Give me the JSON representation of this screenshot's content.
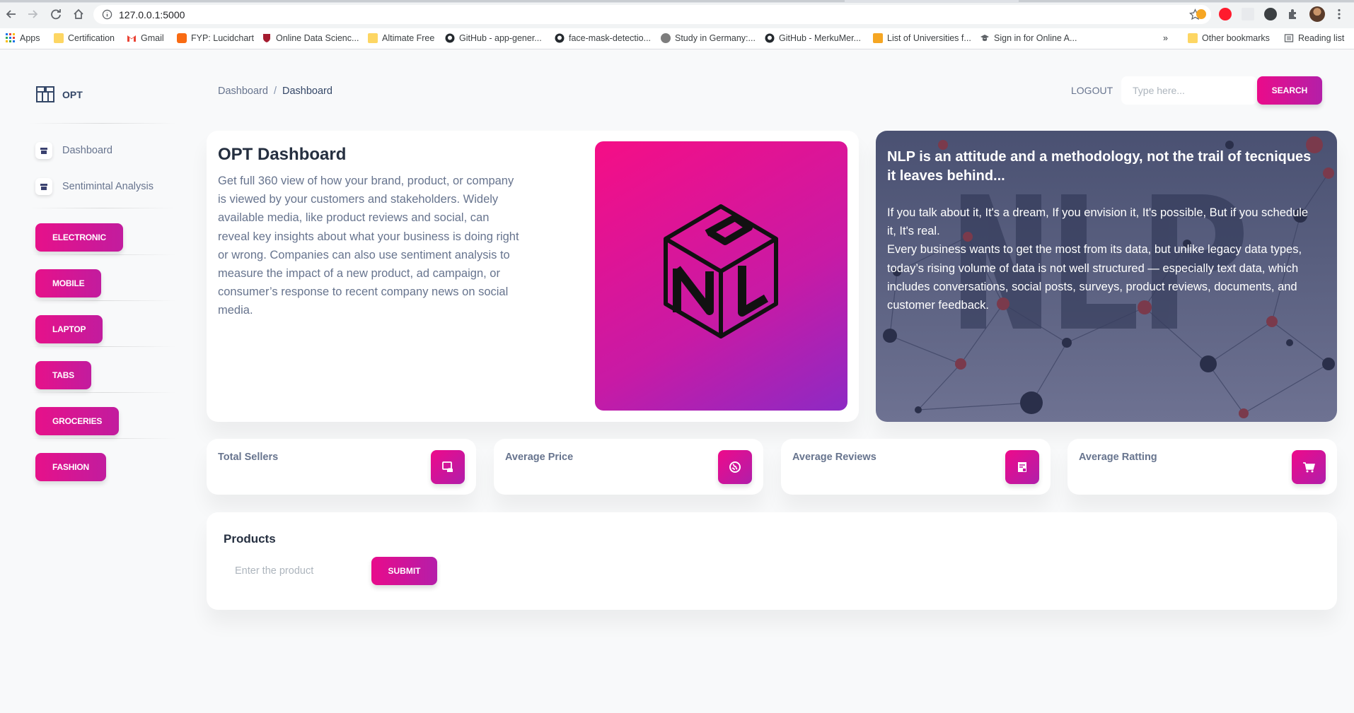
{
  "browser": {
    "url": "127.0.0.1:5000",
    "bookmarks": [
      {
        "label": "Apps",
        "icon": "apps-grid-icon"
      },
      {
        "label": "Certification",
        "icon": "folder-icon"
      },
      {
        "label": "Gmail",
        "icon": "gmail-icon"
      },
      {
        "label": "FYP: Lucidchart",
        "icon": "lucidchart-icon"
      },
      {
        "label": "Online Data Scienc...",
        "icon": "harvard-shield-icon"
      },
      {
        "label": "Altimate Free",
        "icon": "folder-icon"
      },
      {
        "label": "GitHub - app-gener...",
        "icon": "github-icon"
      },
      {
        "label": "face-mask-detectio...",
        "icon": "github-icon"
      },
      {
        "label": "Study in Germany:...",
        "icon": "study-icon"
      },
      {
        "label": "GitHub - MerkuMer...",
        "icon": "github-icon"
      },
      {
        "label": "List of Universities f...",
        "icon": "universities-icon"
      },
      {
        "label": "Sign in for Online A...",
        "icon": "graduation-cap-icon"
      }
    ],
    "overflow": "»",
    "other_bookmarks": "Other bookmarks",
    "reading_list": "Reading list"
  },
  "sidebar": {
    "brand": "OPT",
    "nav": [
      {
        "label": "Dashboard",
        "icon": "shop-icon"
      },
      {
        "label": "Sentimintal Analysis",
        "icon": "shop-icon"
      }
    ],
    "categories": [
      "ELECTRONIC",
      "MOBILE",
      "LAPTOP",
      "TABS",
      "GROCERIES",
      "FASHION"
    ]
  },
  "header": {
    "breadcrumb": [
      "Dashboard",
      "Dashboard"
    ],
    "breadcrumb_sep": "/",
    "logout": "LOGOUT",
    "search_placeholder": "Type here...",
    "search_button": "SEARCH"
  },
  "intro": {
    "title": "OPT Dashboard",
    "text": "Get full 360 view of how your brand, product, or company is viewed by your customers and stakeholders. Widely available media, like product reviews and social, can reveal key insights about what your business is doing right or wrong. Companies can also use sentiment analysis to measure the impact of a new product, ad campaign, or consumer’s response to recent company news on social media."
  },
  "nlp_card": {
    "title": "NLP is an attitude and a methodology, not the trail of tecniques it leaves behind...",
    "paragraph1": "If you talk about it, It's a dream, If you envision it, It's possible, But if you schedule it, It's real.",
    "paragraph2": "Every business wants to get the most from its data, but unlike legacy data types, today’s rising volume of data is not well structured — especially text data, which includes conversations, social posts, surveys, product reviews, documents, and customer feedback."
  },
  "stats": [
    {
      "label": "Total Sellers",
      "icon": "database-icon"
    },
    {
      "label": "Average Price",
      "icon": "world-icon"
    },
    {
      "label": "Average Reviews",
      "icon": "document-icon"
    },
    {
      "label": "Average Ratting",
      "icon": "cart-icon"
    }
  ],
  "products": {
    "title": "Products",
    "input_placeholder": "Enter the product",
    "submit": "SUBMIT"
  },
  "colors": {
    "accent_start": "#ea0b8a",
    "accent_end": "#b01eaa",
    "page_bg": "#f8f9fa",
    "nlp_bg": "#4a5172"
  }
}
